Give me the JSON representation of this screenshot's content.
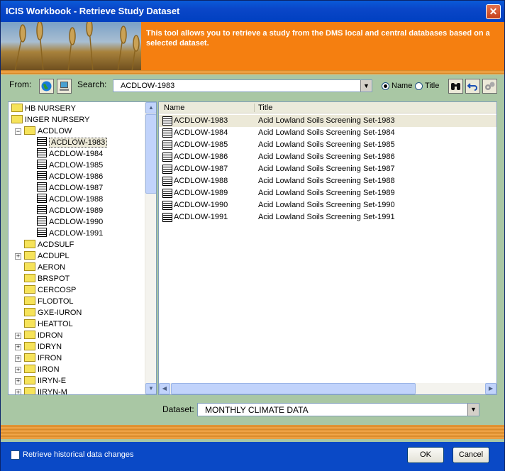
{
  "window": {
    "title": "ICIS Workbook - Retrieve Study Dataset",
    "close": "✕"
  },
  "banner": {
    "text": "This tool allows you to retrieve a study from the DMS local and central databases based on a selected dataset."
  },
  "toolbar": {
    "from_label": "From:",
    "search_label": "Search:",
    "search_value": "ACDLOW-1983",
    "radio_name": "Name",
    "radio_title": "Title",
    "radio_selected": "Name"
  },
  "tree": {
    "top": [
      "HB NURSERY",
      "INGER NURSERY"
    ],
    "expanded_folder": "ACDLOW",
    "children": [
      "ACDLOW-1983",
      "ACDLOW-1984",
      "ACDLOW-1985",
      "ACDLOW-1986",
      "ACDLOW-1987",
      "ACDLOW-1988",
      "ACDLOW-1989",
      "ACDLOW-1990",
      "ACDLOW-1991"
    ],
    "folders": [
      {
        "label": "ACDSULF",
        "expandable": false
      },
      {
        "label": "ACDUPL",
        "expandable": true
      },
      {
        "label": "AERON",
        "expandable": false
      },
      {
        "label": "BRSPOT",
        "expandable": false
      },
      {
        "label": "CERCOSP",
        "expandable": false
      },
      {
        "label": "FLODTOL",
        "expandable": false
      },
      {
        "label": "GXE-IURON",
        "expandable": false
      },
      {
        "label": "HEATTOL",
        "expandable": false
      },
      {
        "label": "IDRON",
        "expandable": true
      },
      {
        "label": "IDRYN",
        "expandable": true
      },
      {
        "label": "IFRON",
        "expandable": true
      },
      {
        "label": "IIRON",
        "expandable": true
      },
      {
        "label": "IIRYN-E",
        "expandable": true
      },
      {
        "label": "IIRYN-M",
        "expandable": true
      }
    ]
  },
  "list": {
    "columns": [
      "Name",
      "Title"
    ],
    "rows": [
      {
        "name": "ACDLOW-1983",
        "title": "Acid Lowland Soils Screening Set-1983"
      },
      {
        "name": "ACDLOW-1984",
        "title": "Acid Lowland Soils Screening Set-1984"
      },
      {
        "name": "ACDLOW-1985",
        "title": "Acid Lowland Soils Screening Set-1985"
      },
      {
        "name": "ACDLOW-1986",
        "title": "Acid Lowland Soils Screening Set-1986"
      },
      {
        "name": "ACDLOW-1987",
        "title": "Acid Lowland Soils Screening Set-1987"
      },
      {
        "name": "ACDLOW-1988",
        "title": "Acid Lowland Soils Screening Set-1988"
      },
      {
        "name": "ACDLOW-1989",
        "title": "Acid Lowland Soils Screening Set-1989"
      },
      {
        "name": "ACDLOW-1990",
        "title": "Acid Lowland Soils Screening Set-1990"
      },
      {
        "name": "ACDLOW-1991",
        "title": "Acid Lowland Soils Screening Set-1991"
      }
    ]
  },
  "dataset": {
    "label": "Dataset:",
    "value": "MONTHLY CLIMATE DATA"
  },
  "footer": {
    "history_label": "Retrieve historical data changes",
    "ok": "OK",
    "cancel": "Cancel"
  },
  "colors": {
    "accent": "#f57f10",
    "titlebar": "#0a46c8",
    "panel_bg": "#a9c7a4"
  }
}
